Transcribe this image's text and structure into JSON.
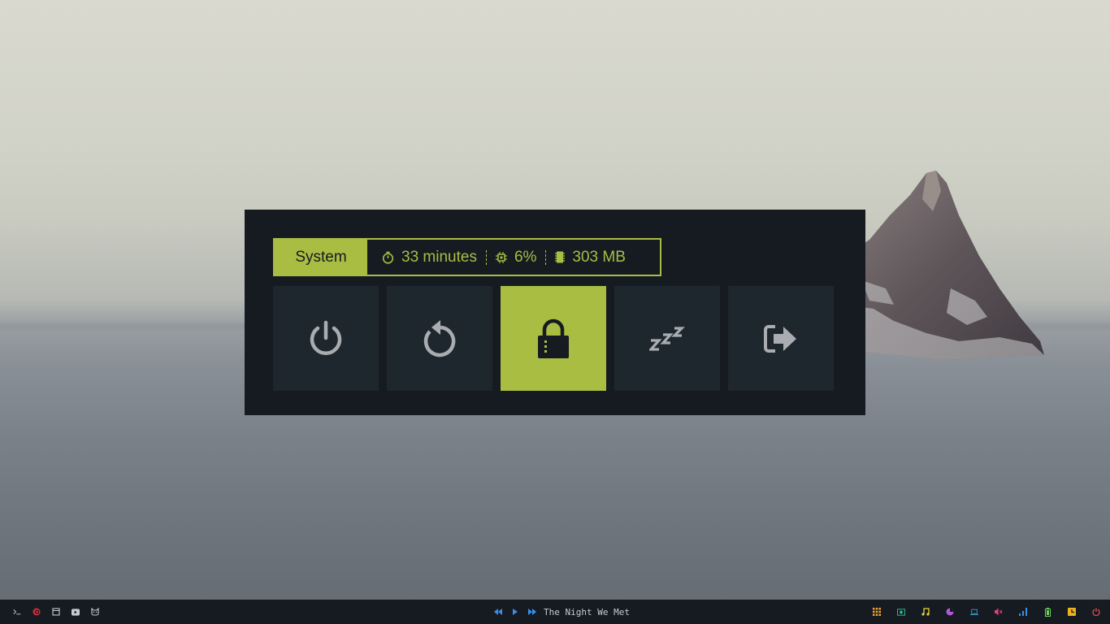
{
  "power_menu": {
    "title": "System",
    "uptime": "33 minutes",
    "cpu": "6%",
    "memory": "303 MB",
    "accent_color": "#a9bd43",
    "buttons": [
      {
        "icon": "power-icon"
      },
      {
        "icon": "restart-icon"
      },
      {
        "icon": "lock-icon",
        "selected": true
      },
      {
        "icon": "sleep-icon"
      },
      {
        "icon": "logout-icon"
      }
    ]
  },
  "taskbar": {
    "left_icons": [
      "terminal-icon",
      "debian-icon",
      "files-icon",
      "youtube-icon",
      "cat-icon"
    ],
    "media": {
      "now_playing": "The Night We Met",
      "controls": [
        "previous-icon",
        "play-icon",
        "next-icon"
      ]
    },
    "right_icons": [
      {
        "icon": "apps-icon",
        "color": "#f0a030"
      },
      {
        "icon": "screenshot-icon",
        "color": "#2fbf9f"
      },
      {
        "icon": "music-icon",
        "color": "#e5d23a"
      },
      {
        "icon": "disk-icon",
        "color": "#b05ad6"
      },
      {
        "icon": "laptop-icon",
        "color": "#3aa6d8"
      },
      {
        "icon": "volume-mute-icon",
        "color": "#e0457b"
      },
      {
        "icon": "signal-icon",
        "color": "#3a8ee6"
      },
      {
        "icon": "battery-icon",
        "color": "#6fcf5f"
      },
      {
        "icon": "clock-icon",
        "color": "#f0b020"
      },
      {
        "icon": "power-icon",
        "color": "#e24a4a"
      }
    ]
  }
}
